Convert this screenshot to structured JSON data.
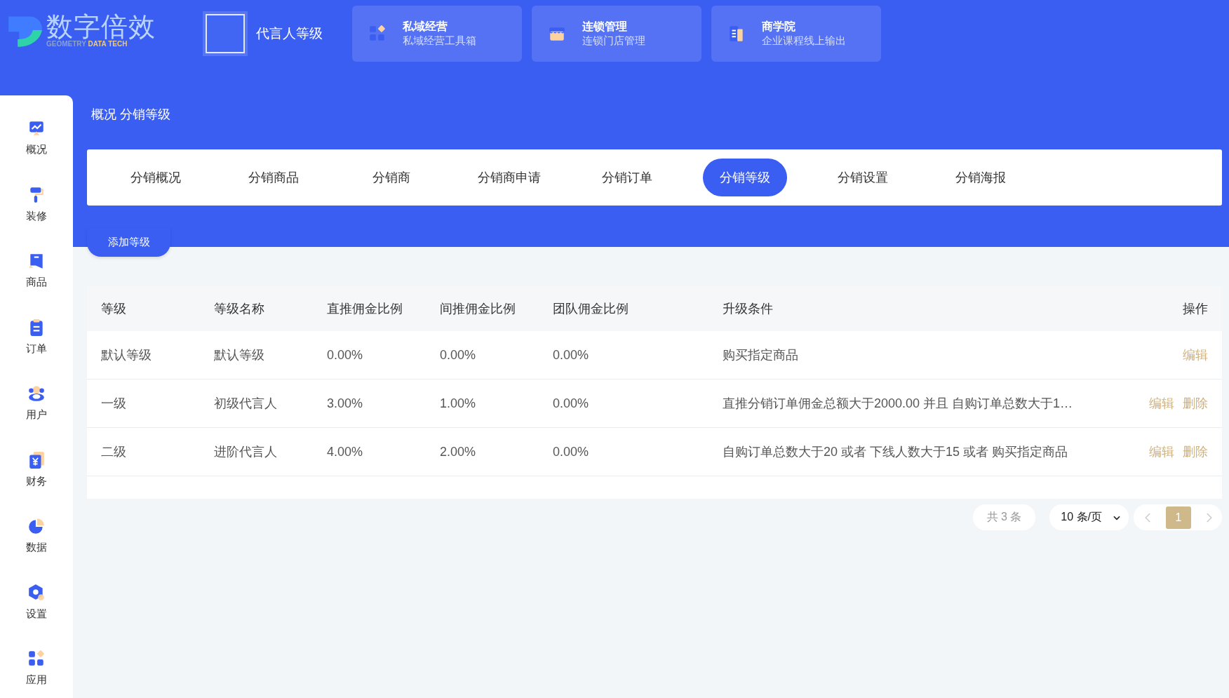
{
  "logo": {
    "title": "数字倍效",
    "subtitle": "GEOMETRY",
    "subtitle_highlight": "DATA TECH"
  },
  "header": {
    "current_page": "代言人等级",
    "apps": [
      {
        "kind": "grid",
        "title": "私域经营",
        "subtitle": "私域经营工具箱"
      },
      {
        "kind": "store",
        "title": "连锁管理",
        "subtitle": "连锁门店管理"
      },
      {
        "kind": "book",
        "title": "商学院",
        "subtitle": "企业课程线上输出"
      }
    ]
  },
  "sidebar": {
    "items": [
      {
        "kind": "chart",
        "label": "概况"
      },
      {
        "kind": "roller",
        "label": "装修"
      },
      {
        "kind": "goods",
        "label": "商品"
      },
      {
        "kind": "order",
        "label": "订单"
      },
      {
        "kind": "user",
        "label": "用户"
      },
      {
        "kind": "finance",
        "label": "财务"
      },
      {
        "kind": "pie",
        "label": "数据"
      },
      {
        "kind": "settings",
        "label": "设置"
      },
      {
        "kind": "apps",
        "label": "应用"
      }
    ]
  },
  "breadcrumb": "概况 分销等级",
  "tabs": [
    {
      "label": "分销概况",
      "selected": false
    },
    {
      "label": "分销商品",
      "selected": false
    },
    {
      "label": "分销商",
      "selected": false
    },
    {
      "label": "分销商申请",
      "selected": false
    },
    {
      "label": "分销订单",
      "selected": false
    },
    {
      "label": "分销等级",
      "selected": true
    },
    {
      "label": "分销设置",
      "selected": false
    },
    {
      "label": "分销海报",
      "selected": false
    }
  ],
  "add_button": "添加等级",
  "table": {
    "columns": [
      "等级",
      "等级名称",
      "直推佣金比例",
      "间推佣金比例",
      "团队佣金比例",
      "升级条件",
      "操作"
    ],
    "rows": [
      {
        "cells": [
          "默认等级",
          "默认等级",
          "0.00%",
          "0.00%",
          "0.00%",
          "购买指定商品"
        ],
        "actions": [
          "编辑"
        ]
      },
      {
        "cells": [
          "一级",
          "初级代言人",
          "3.00%",
          "1.00%",
          "0.00%",
          "直推分销订单佣金总额大于2000.00 并且 自购订单总数大于1…"
        ],
        "actions": [
          "编辑",
          "删除"
        ]
      },
      {
        "cells": [
          "二级",
          "进阶代言人",
          "4.00%",
          "2.00%",
          "0.00%",
          "自购订单总数大于20 或者 下线人数大于15 或者 购买指定商品"
        ],
        "actions": [
          "编辑",
          "删除"
        ]
      }
    ]
  },
  "pagination": {
    "total": "共 3 条",
    "page_size": "10 条/页",
    "pages": [
      {
        "label": "1",
        "selected": true
      }
    ]
  }
}
